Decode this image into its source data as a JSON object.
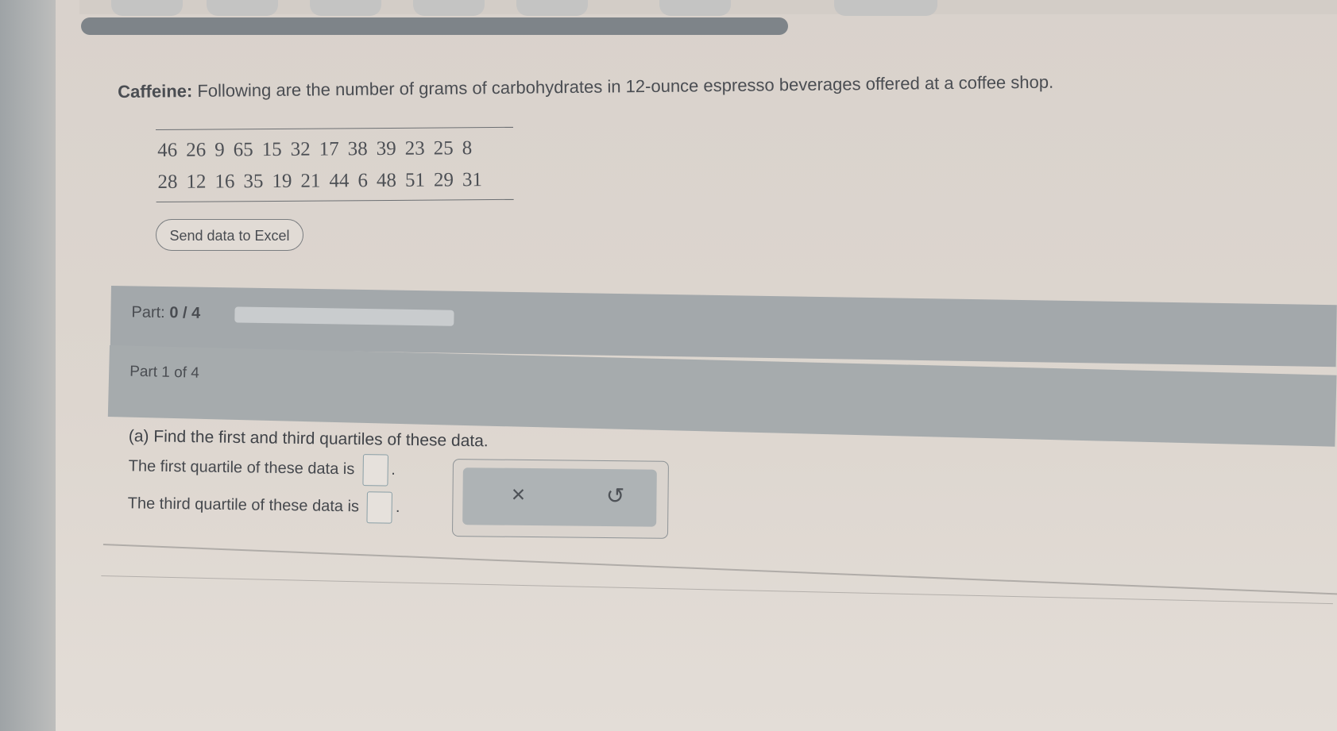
{
  "question": {
    "label": "Caffeine:",
    "text": " Following are the number of grams of carbohydrates in 12-ounce espresso beverages offered at a coffee shop."
  },
  "data_table": {
    "rows": [
      [
        "46",
        "26",
        "9",
        "65",
        "15",
        "32",
        "17",
        "38",
        "39",
        "23",
        "25",
        "8"
      ],
      [
        "28",
        "12",
        "16",
        "35",
        "19",
        "21",
        "44",
        "6",
        "48",
        "51",
        "29",
        "31"
      ]
    ]
  },
  "excel_button_label": "Send data to Excel",
  "part_progress": {
    "label": "Part:",
    "value": "0 / 4",
    "completed": 0,
    "total": 4
  },
  "part_header": "Part 1 of 4",
  "prompt": "(a) Find the first and third quartiles of these data.",
  "first_quartile": {
    "text": "The first quartile of these data is",
    "value": ""
  },
  "third_quartile": {
    "text": "The third quartile of these data is",
    "value": ""
  },
  "punct": ".",
  "controls": {
    "clear_icon": "×",
    "undo_icon": "↺"
  }
}
